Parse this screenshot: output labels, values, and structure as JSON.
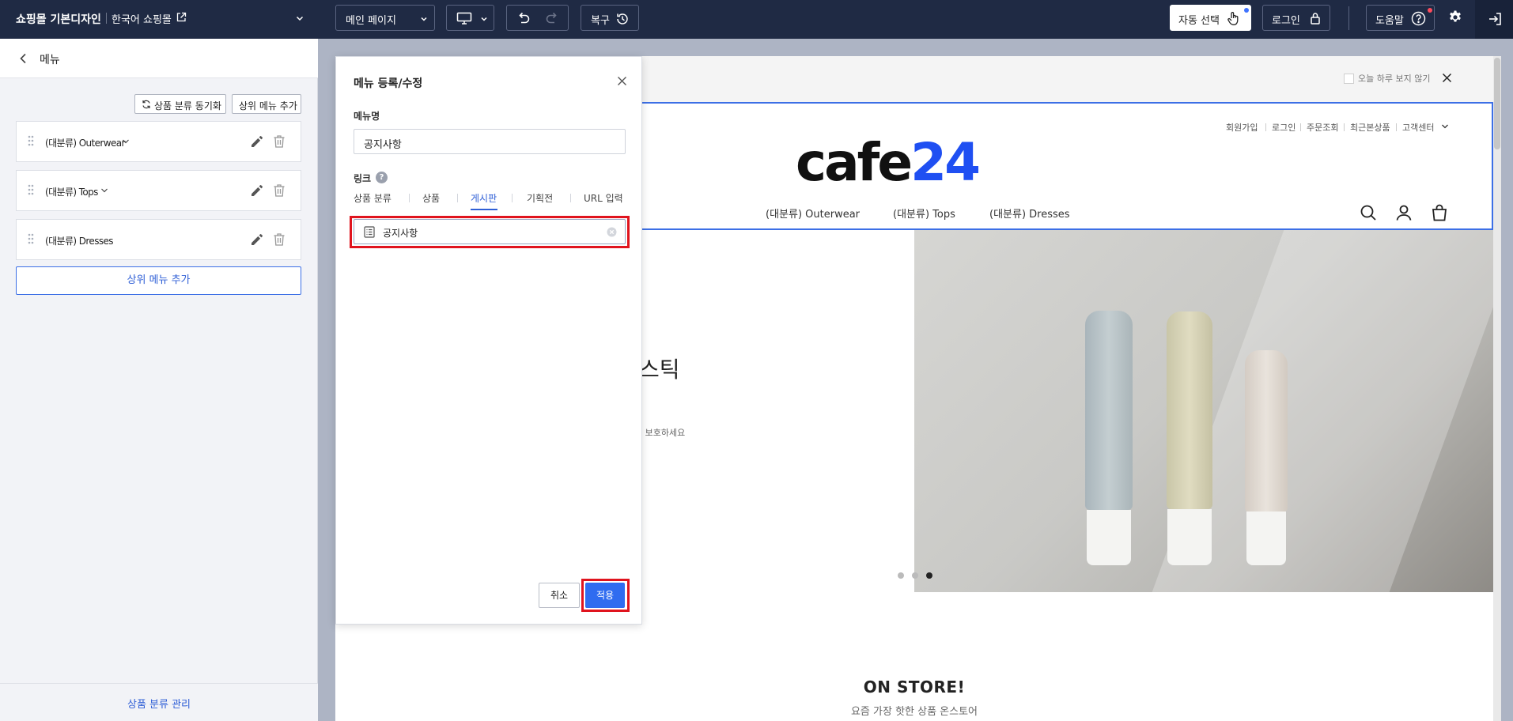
{
  "topbar": {
    "title": "쇼핑몰 기본디자인",
    "shop_name": "한국어 쇼핑몰",
    "page_select": "메인 페이지",
    "restore": "복구",
    "auto_select": "자동 선택",
    "login": "로그인",
    "help": "도움말"
  },
  "left_panel": {
    "title": "메뉴",
    "sync_button": "상품 분류 동기화",
    "add_top_small": "상위 메뉴 추가",
    "items": [
      {
        "label": "(대분류) Outerwear"
      },
      {
        "label": "(대분류) Tops"
      },
      {
        "label": "(대분류) Dresses"
      }
    ],
    "add_top": "상위 메뉴 추가",
    "footer_link": "상품 분류 관리"
  },
  "modal": {
    "title": "메뉴 등록/수정",
    "menu_name_label": "메뉴명",
    "menu_name_value": "공지사항",
    "link_label": "링크",
    "help_mark": "?",
    "tabs": [
      "상품 분류",
      "상품",
      "게시판",
      "기획전",
      "URL 입력"
    ],
    "active_tab": "게시판",
    "board_value": "공지사항",
    "cancel": "취소",
    "apply": "적용"
  },
  "preview": {
    "dont_show_today": "오늘 하루 보지 않기",
    "util_links": [
      "회원가입",
      "로그인",
      "주문조회",
      "최근본상품",
      "고객센터"
    ],
    "logo_cafe": "cafe",
    "logo_24": "24",
    "nav": [
      "(대분류) Outerwear",
      "(대분류) Tops",
      "(대분류) Dresses"
    ],
    "hero_title_fragment": "스틱",
    "hero_sub_fragment": "를 보호하세요",
    "section_title": "ON STORE!",
    "section_sub": "요즘 가장 핫한 상품 온스토어"
  },
  "colors": {
    "topbar_bg": "#1f2a44",
    "accent_blue": "#2f6cf0",
    "highlight_red": "#e0141e",
    "logo_blue": "#1f4ff2"
  }
}
